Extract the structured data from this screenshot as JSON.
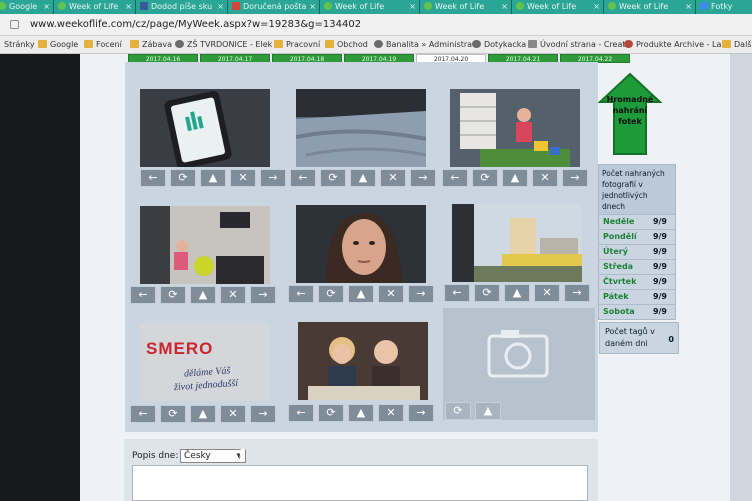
{
  "browser": {
    "tabs": [
      "Google",
      "Dodod píše sku",
      "Week of Life",
      "Doručená pošta",
      "Week of Life",
      "Week of Life",
      "Week of Life",
      "Week of Life",
      "Fotky"
    ],
    "url": "www.weekoflife.com/cz/page/MyWeek.aspx?w=19283&g=134402"
  },
  "bookmarks": [
    "Stránky",
    "Google",
    "Focení",
    "Zábava",
    "ZŠ TVRDONICE - Elek",
    "Pracovní",
    "Obchod",
    "Banalita » Administra",
    "Dotykacka",
    "Úvodní strana - Creati",
    "Produkte Archive - La",
    "Dalš"
  ],
  "day_tabs": [
    "2017.04.16",
    "2017.04.17",
    "2017.04.18",
    "2017.04.19",
    "2017.04.20",
    "2017.04.21",
    "2017.04.22"
  ],
  "photo_buttons": {
    "left": "arrow-left-icon",
    "rotate": "rotate-icon",
    "up": "arrow-up-icon",
    "delete": "close-icon",
    "right": "arrow-right-icon"
  },
  "ad": {
    "brand": "SMERO",
    "slogan1": "děláme Váš",
    "slogan2": "život jednodušší"
  },
  "upload": {
    "label": "Hromadné nahrání fotek"
  },
  "counts": {
    "header": "Počet nahraných fotografií v jednotlivých dnech",
    "rows": [
      {
        "day": "Neděle",
        "value": "9/9"
      },
      {
        "day": "Pondělí",
        "value": "9/9"
      },
      {
        "day": "Úterý",
        "value": "9/9"
      },
      {
        "day": "Středa",
        "value": "9/9"
      },
      {
        "day": "Čtvrtek",
        "value": "9/9"
      },
      {
        "day": "Pátek",
        "value": "9/9"
      },
      {
        "day": "Sobota",
        "value": "9/9"
      }
    ]
  },
  "tags": {
    "label": "Počet tagů v daném dni",
    "value": "0"
  },
  "description": {
    "label": "Popis dne:",
    "language": "Česky"
  }
}
